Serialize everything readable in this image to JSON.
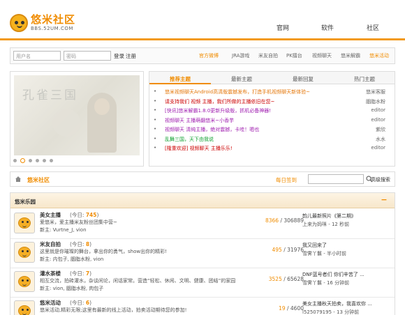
{
  "header": {
    "brand_name": "悠米社区",
    "brand_url": "BBS.52UM.COM",
    "nav": [
      "官网",
      "软件",
      "社区"
    ]
  },
  "login": {
    "username_placeholder": "用户名",
    "password_placeholder": "密码",
    "login_label": "登录",
    "register_label": "注册",
    "quick_links": [
      "官方微博",
      "JRA游戏",
      "米友自拍",
      "PK擂台",
      "视频聊天",
      "悠米解霸",
      "悠米活动"
    ]
  },
  "slider": {
    "calligraphy_text": "孔雀三国",
    "dots_count": 6
  },
  "topics_panel": {
    "tabs": [
      "推荐主题",
      "最新主题",
      "最新回复",
      "热门主题"
    ],
    "topics": [
      {
        "title": "悠米视频聊天Android高清版震撼发布，打造手机视频聊天新体验~",
        "author": "悠米客服",
        "color": "#e4770a"
      },
      {
        "title": "请支持我们 视频 主播，我们所做的主播依旧在您~",
        "author": "胭脂水粉",
        "color": "#cc0000"
      },
      {
        "title": "[快讯]悠米解霸1.8.0更新升级版，抓机必备神器!",
        "author": "editor",
        "color": "#a020b0"
      },
      {
        "title": "视频聊天 主播萌翻悠米~小香芋",
        "author": "editor",
        "color": "#a020b0"
      },
      {
        "title": "视频聊天 清纯主播，绝对震撼，卡哇！嗯也",
        "author": "紫欣",
        "color": "#a020b0"
      },
      {
        "title": "乱舞三国，天下由我说",
        "author": "水水",
        "color": "#10a030"
      },
      {
        "title": "[隆重欢迎] 视频聊天 主播乐乐!",
        "author": "editor",
        "color": "#cc0000"
      }
    ]
  },
  "sitebar": {
    "crumb": "悠米社区",
    "sign": "每日签到",
    "advanced_search": "高级搜索"
  },
  "forum": {
    "section_title": "悠米乐园",
    "collapse": "−",
    "rows": [
      {
        "name": "美女主播",
        "today_label": "(今日:",
        "today": "745",
        "today_end": ")",
        "desc": "爱悠米，爱主播米友粉丝团集中营~",
        "mods": "新主: Vurtne_J, vion",
        "threads": "8366",
        "posts": "306889",
        "last_title": "韵儿最新照片《第二期》",
        "last_meta": "上来为妈咪 - 12 秒前"
      },
      {
        "name": "米友自拍",
        "today_label": "(今日:",
        "today": "8",
        "today_end": ")",
        "desc": "这里就是你璀璨的舞台，拿出你的勇气，show出你的精彩!",
        "mods": "新主: 内包子, 胭脂水粉, vion",
        "threads": "495",
        "posts": "31976",
        "last_title": "我又回来了",
        "last_meta": "雪霁丫鬟 - 半小时前"
      },
      {
        "name": "灌水茶楼",
        "today_label": "(今日:",
        "today": "7",
        "today_end": ")",
        "desc": "相互交流，拍砖灌水，杂谈闲论，闲话家常。营造“轻松、休闲、文明、健康、团结”的家园",
        "mods": "新主: vion, 胭脂水粉, 肉包子",
        "threads": "3525",
        "posts": "65628",
        "last_title": "DNF蓝号者们 你们辛苦了 ...",
        "last_meta": "雪霁丫鬟 - 16 分钟前"
      },
      {
        "name": "悠米活动",
        "today_label": "(今日:",
        "today": "6",
        "today_end": ")",
        "desc": "悠米活动,精彩无限;这里有最新的线上活动，拍卖活动期待您的参加!",
        "mods": "",
        "threads": "19",
        "posts": "4600",
        "last_title": "美女主播秋天拍卖，我喜欢你 ...",
        "last_meta": "l525079195 - 13 分钟前"
      }
    ]
  },
  "colors": {
    "accent": "#f08c00",
    "border": "#dddddd"
  }
}
